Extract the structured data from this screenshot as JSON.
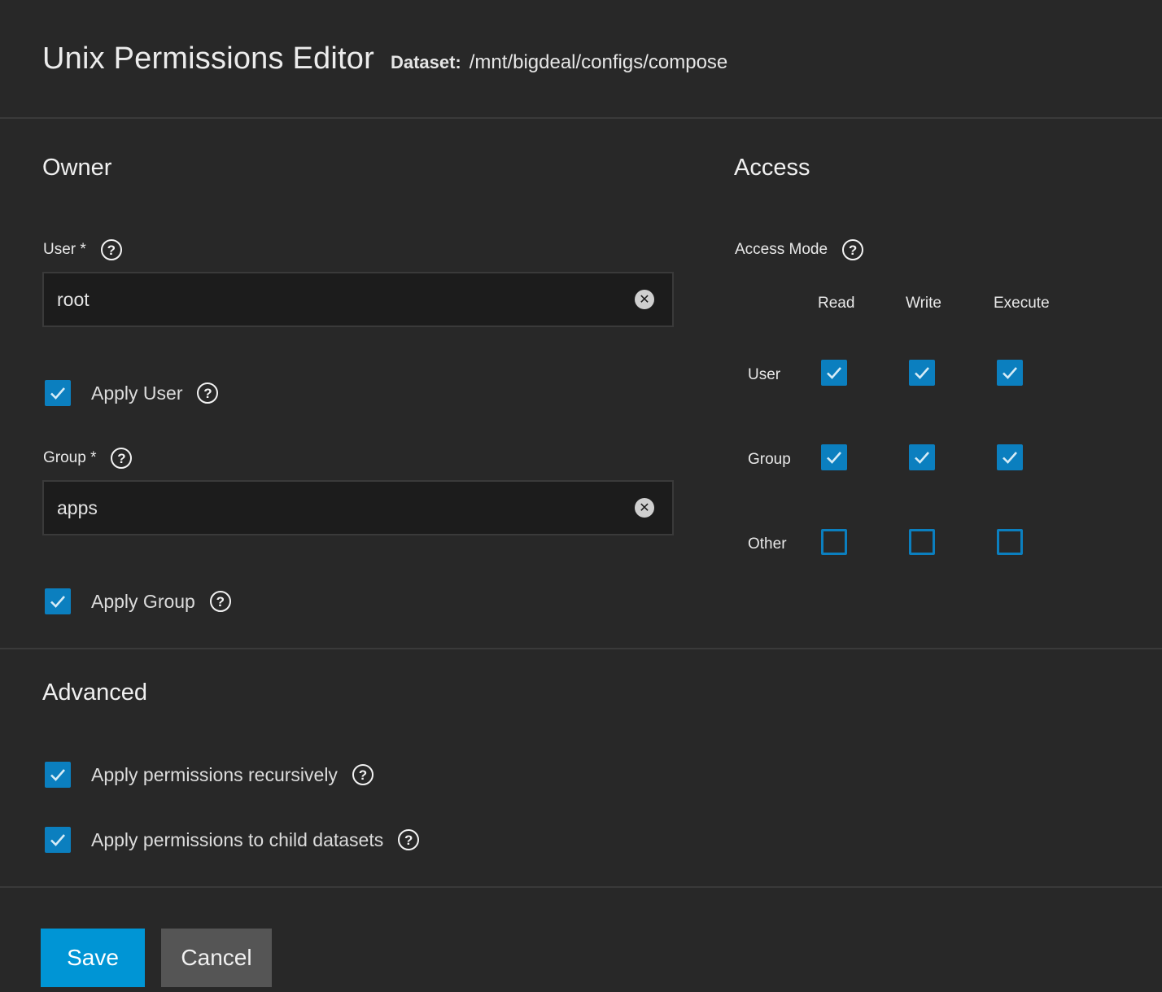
{
  "header": {
    "title": "Unix Permissions Editor",
    "dataset_label": "Dataset:",
    "dataset_path": "/mnt/bigdeal/configs/compose"
  },
  "owner": {
    "title": "Owner",
    "user_label": "User *",
    "user_value": "root",
    "apply_user_label": "Apply User",
    "apply_user_checked": true,
    "group_label": "Group *",
    "group_value": "apps",
    "apply_group_label": "Apply Group",
    "apply_group_checked": true
  },
  "access": {
    "title": "Access",
    "mode_label": "Access Mode",
    "columns": [
      "Read",
      "Write",
      "Execute"
    ],
    "rows": [
      {
        "label": "User",
        "values": [
          true,
          true,
          true
        ]
      },
      {
        "label": "Group",
        "values": [
          true,
          true,
          true
        ]
      },
      {
        "label": "Other",
        "values": [
          false,
          false,
          false
        ]
      }
    ]
  },
  "advanced": {
    "title": "Advanced",
    "recursive_label": "Apply permissions recursively",
    "recursive_checked": true,
    "child_label": "Apply permissions to child datasets",
    "child_checked": true
  },
  "actions": {
    "save_label": "Save",
    "cancel_label": "Cancel"
  },
  "colors": {
    "accent": "#0b7fbf",
    "primary_button": "#0095d5",
    "background": "#282828"
  },
  "icons": {
    "help": "help-circle-icon",
    "clear": "clear-circle-icon",
    "check": "check-icon"
  }
}
